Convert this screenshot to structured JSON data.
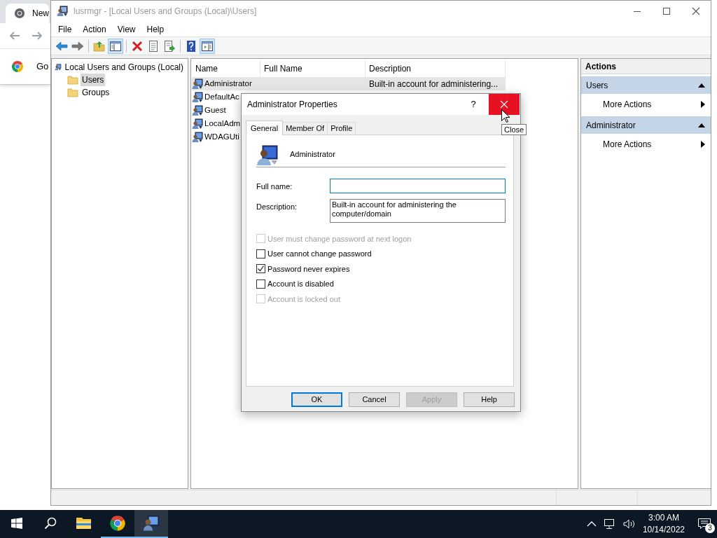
{
  "background_browser": {
    "tab_title": "New",
    "bookmark": "Go"
  },
  "window": {
    "title": "lusrmgr - [Local Users and Groups (Local)\\Users]",
    "active": false
  },
  "menu": [
    "File",
    "Action",
    "View",
    "Help"
  ],
  "toolbar": [
    {
      "kind": "back",
      "pressed": false
    },
    {
      "kind": "forward",
      "pressed": false
    },
    {
      "kind": "separator"
    },
    {
      "kind": "up",
      "pressed": false
    },
    {
      "kind": "tree",
      "pressed": true
    },
    {
      "kind": "separator"
    },
    {
      "kind": "delete",
      "pressed": false
    },
    {
      "kind": "properties",
      "pressed": false
    },
    {
      "kind": "export",
      "pressed": false
    },
    {
      "kind": "separator"
    },
    {
      "kind": "help",
      "pressed": false
    },
    {
      "kind": "action-pane",
      "pressed": true
    }
  ],
  "tree": [
    {
      "label": "Local Users and Groups (Local)",
      "selected": false,
      "children": [
        {
          "label": "Users",
          "selected": true
        },
        {
          "label": "Groups",
          "selected": false
        }
      ]
    }
  ],
  "table": {
    "columns": [
      "Name",
      "Full Name",
      "Description"
    ],
    "rows": [
      {
        "name": "Administrator",
        "description": "Built-in account for administering...",
        "selected": true
      },
      {
        "name": "DefaultAc",
        "selected": false
      },
      {
        "name": "Guest",
        "selected": false
      },
      {
        "name": "LocalAdm",
        "selected": false
      },
      {
        "name": "WDAGUti",
        "selected": false
      }
    ]
  },
  "actions": {
    "title": "Actions",
    "sections": [
      {
        "title": "Users",
        "expanded": true,
        "items": [
          "More Actions"
        ]
      },
      {
        "title": "Administrator",
        "expanded": true,
        "items": [
          "More Actions"
        ]
      }
    ]
  },
  "dialog": {
    "title": "Administrator Properties",
    "help": "?",
    "close_hovered": true,
    "tooltip": "Close",
    "tabs": [
      {
        "label": "General",
        "selected": true
      },
      {
        "label": "Member Of",
        "selected": false
      },
      {
        "label": "Profile",
        "selected": false
      }
    ],
    "user_name": "Administrator",
    "fields": [
      {
        "label": "Full name:",
        "focused": true,
        "multiline": false
      },
      {
        "label": "Description:",
        "value": "Built-in account for administering the computer/domain",
        "focused": false,
        "multiline": true
      }
    ],
    "checkboxes": [
      {
        "label": "User must change password at next logon",
        "checked": false,
        "disabled": true
      },
      {
        "label": "User cannot change password",
        "checked": false,
        "disabled": false
      },
      {
        "label": "Password never expires",
        "checked": true,
        "disabled": false
      },
      {
        "label": "Account is disabled",
        "checked": false,
        "disabled": false
      },
      {
        "label": "Account is locked out",
        "checked": false,
        "disabled": true
      }
    ],
    "buttons": [
      {
        "label": "OK",
        "default": true,
        "disabled": false
      },
      {
        "label": "Cancel",
        "default": false,
        "disabled": false
      },
      {
        "label": "Apply",
        "default": false,
        "disabled": true
      },
      {
        "label": "Help",
        "default": false,
        "disabled": false
      }
    ]
  },
  "taskbar": {
    "apps": [
      {
        "kind": "explorer",
        "running": false,
        "selected": false
      },
      {
        "kind": "chrome",
        "running": true,
        "selected": false
      },
      {
        "kind": "lusrmgr",
        "running": true,
        "selected": true
      }
    ],
    "time": "3:00 AM",
    "date": "10/14/2022",
    "notifications": "3"
  }
}
